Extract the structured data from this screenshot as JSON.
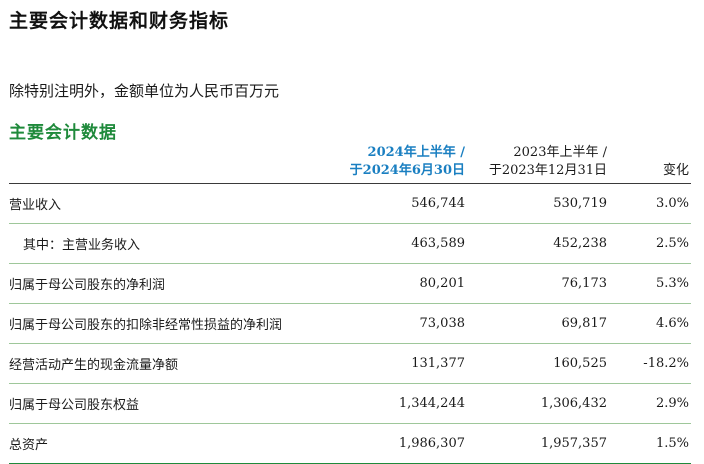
{
  "page_title": "主要会计数据和财务指标",
  "unit_note": "除特别注明外，金额单位为人民币百万元",
  "section_title": "主要会计数据",
  "columns": {
    "current_line1": "2024年上半年 /",
    "current_line2": "于2024年6月30日",
    "prior_line1": "2023年上半年 /",
    "prior_line2": "于2023年12月31日",
    "change": "变化"
  },
  "rows": [
    {
      "label": "营业收入",
      "current": "546,744",
      "prior": "530,719",
      "change": "3.0%"
    },
    {
      "label": "其中：主营业务收入",
      "current": "463,589",
      "prior": "452,238",
      "change": "2.5%"
    },
    {
      "label": "归属于母公司股东的净利润",
      "current": "80,201",
      "prior": "76,173",
      "change": "5.3%"
    },
    {
      "label": "归属于母公司股东的扣除非经常性损益的净利润",
      "current": "73,038",
      "prior": "69,817",
      "change": "4.6%"
    },
    {
      "label": "经营活动产生的现金流量净额",
      "current": "131,377",
      "prior": "160,525",
      "change": "-18.2%"
    },
    {
      "label": "归属于母公司股东权益",
      "current": "1,344,244",
      "prior": "1,306,432",
      "change": "2.9%"
    },
    {
      "label": "总资产",
      "current": "1,986,307",
      "prior": "1,957,357",
      "change": "1.5%"
    }
  ]
}
